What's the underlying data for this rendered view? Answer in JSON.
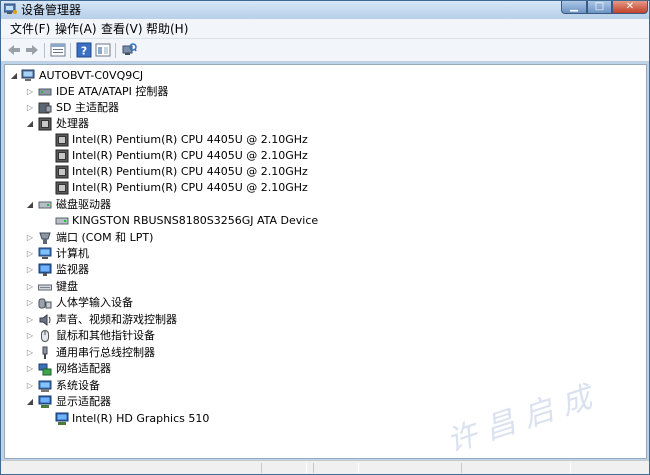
{
  "window": {
    "title": "设备管理器"
  },
  "menu": [
    "文件(F)",
    "操作(A)",
    "查看(V)",
    "帮助(H)"
  ],
  "toolbar": {
    "buttons": [
      "back-arrow-icon",
      "forward-arrow-icon",
      "properties-icon",
      "help-icon",
      "device-view-icon",
      "scan-hardware-icon"
    ]
  },
  "tree": {
    "root": "AUTOBVT-C0VQ9CJ",
    "categories": [
      {
        "label": "IDE ATA/ATAPI 控制器",
        "icon": "ide-controller-icon",
        "expanded": false,
        "children": []
      },
      {
        "label": "SD 主适配器",
        "icon": "sd-adapter-icon",
        "expanded": false,
        "children": []
      },
      {
        "label": "处理器",
        "icon": "processor-icon",
        "expanded": true,
        "children": [
          "Intel(R) Pentium(R) CPU 4405U @ 2.10GHz",
          "Intel(R) Pentium(R) CPU 4405U @ 2.10GHz",
          "Intel(R) Pentium(R) CPU 4405U @ 2.10GHz",
          "Intel(R) Pentium(R) CPU 4405U @ 2.10GHz"
        ]
      },
      {
        "label": "磁盘驱动器",
        "icon": "disk-drive-icon",
        "expanded": true,
        "children": [
          "KINGSTON RBUSNS8180S3256GJ ATA Device"
        ]
      },
      {
        "label": "端口 (COM 和 LPT)",
        "icon": "port-icon",
        "expanded": false,
        "children": []
      },
      {
        "label": "计算机",
        "icon": "computer-icon",
        "expanded": false,
        "children": []
      },
      {
        "label": "监视器",
        "icon": "monitor-icon",
        "expanded": false,
        "children": []
      },
      {
        "label": "键盘",
        "icon": "keyboard-icon",
        "expanded": false,
        "children": []
      },
      {
        "label": "人体学输入设备",
        "icon": "hid-icon",
        "expanded": false,
        "children": []
      },
      {
        "label": "声音、视频和游戏控制器",
        "icon": "sound-icon",
        "expanded": false,
        "children": []
      },
      {
        "label": "鼠标和其他指针设备",
        "icon": "mouse-icon",
        "expanded": false,
        "children": []
      },
      {
        "label": "通用串行总线控制器",
        "icon": "usb-icon",
        "expanded": false,
        "children": []
      },
      {
        "label": "网络适配器",
        "icon": "network-adapter-icon",
        "expanded": false,
        "children": []
      },
      {
        "label": "系统设备",
        "icon": "system-device-icon",
        "expanded": false,
        "children": []
      },
      {
        "label": "显示适配器",
        "icon": "display-adapter-icon",
        "expanded": true,
        "children": [
          "Intel(R) HD Graphics 510"
        ]
      }
    ]
  },
  "watermark": "许昌启成",
  "colors": {
    "selection": "#cce8ff",
    "window_frame": "#bcd3ec"
  }
}
